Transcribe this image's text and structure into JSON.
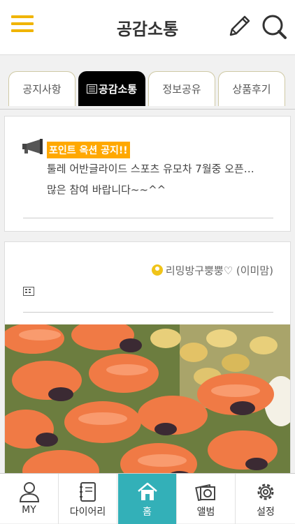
{
  "header": {
    "title": "공감소통"
  },
  "tabs": [
    {
      "label": "공지사항"
    },
    {
      "label": "공감소통"
    },
    {
      "label": "정보공유"
    },
    {
      "label": "상품후기"
    }
  ],
  "notice": {
    "title": "포인트 옥션 공지!!",
    "line1": "툴레 어반글라이드 스포츠 유모차 7월중 오픈…",
    "line2": "많은 참여 바랍니다~~^^"
  },
  "post": {
    "author": "리밍방구뿡뿡♡ (이미맘)"
  },
  "bottom_nav": [
    {
      "label": "MY"
    },
    {
      "label": "다이어리"
    },
    {
      "label": "홈"
    },
    {
      "label": "앨범"
    },
    {
      "label": "설정"
    }
  ],
  "colors": {
    "accent": "#f0b400",
    "active_nav": "#33b0b8",
    "notice_highlight": "#ffa800"
  }
}
